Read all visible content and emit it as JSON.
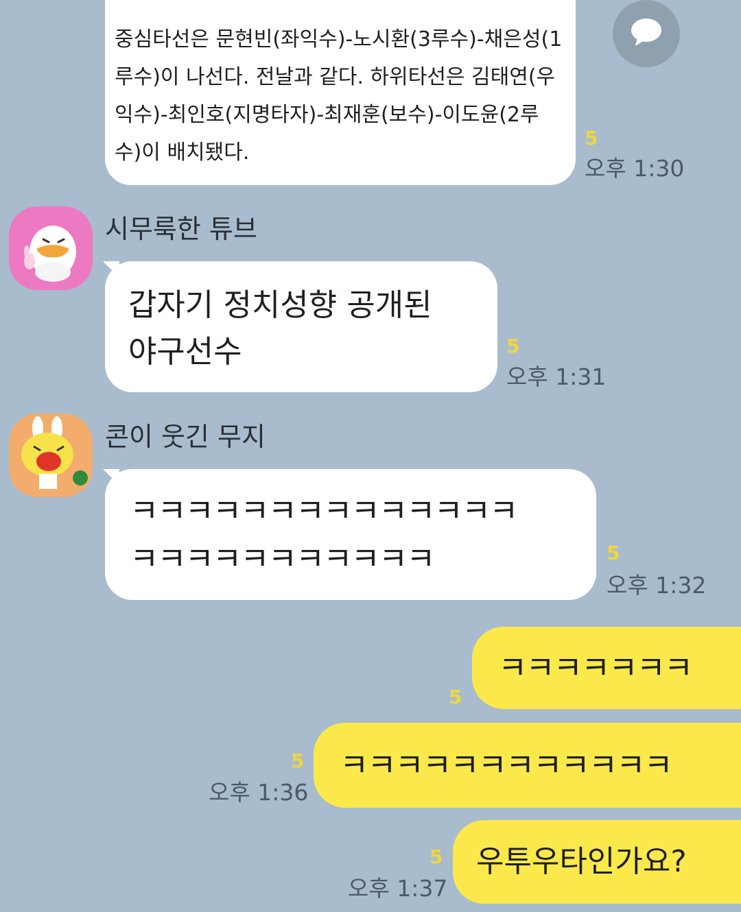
{
  "messages": [
    {
      "text": "중심타선은 문현빈(좌익수)-노시환(3루수)-채은성(1\n루수)이 나선다. 전날과 같다. 하위타선은 김태연(우\n익수)-최인호(지명타자)-최재훈(보수)-이도윤(2루\n수)이 배치됐다.",
      "unread": "5",
      "time": "오후 1:30"
    },
    {
      "sender": "시무룩한 튜브",
      "avatar_icon": "tube-duck-avatar",
      "text": "갑자기 정치성향 공개된\n야구선수",
      "unread": "5",
      "time": "오후 1:31"
    },
    {
      "sender": "콘이 웃긴 무지",
      "avatar_icon": "muzi-laughing-avatar",
      "text": "ㅋㅋㅋㅋㅋㅋㅋㅋㅋㅋㅋㅋㅋㅋ\nㅋㅋㅋㅋㅋㅋㅋㅋㅋㅋㅋ",
      "unread": "5",
      "time": "오후 1:32"
    },
    {
      "text": "ㅋㅋㅋㅋㅋㅋㅋ",
      "unread": "5"
    },
    {
      "text": "ㅋㅋㅋㅋㅋㅋㅋㅋㅋㅋㅋㅋ",
      "unread": "5",
      "time": "오후 1:36"
    },
    {
      "text": "우투우타인가요?",
      "unread": "5",
      "time": "오후 1:37"
    }
  ],
  "share_button": {
    "icon": "speech-bubble-icon"
  },
  "colors": {
    "background": "#a8bccd",
    "incoming_bubble": "#ffffff",
    "outgoing_bubble": "#fbe94b",
    "unread_count": "#f2d63b",
    "timestamp": "#4b5966"
  }
}
